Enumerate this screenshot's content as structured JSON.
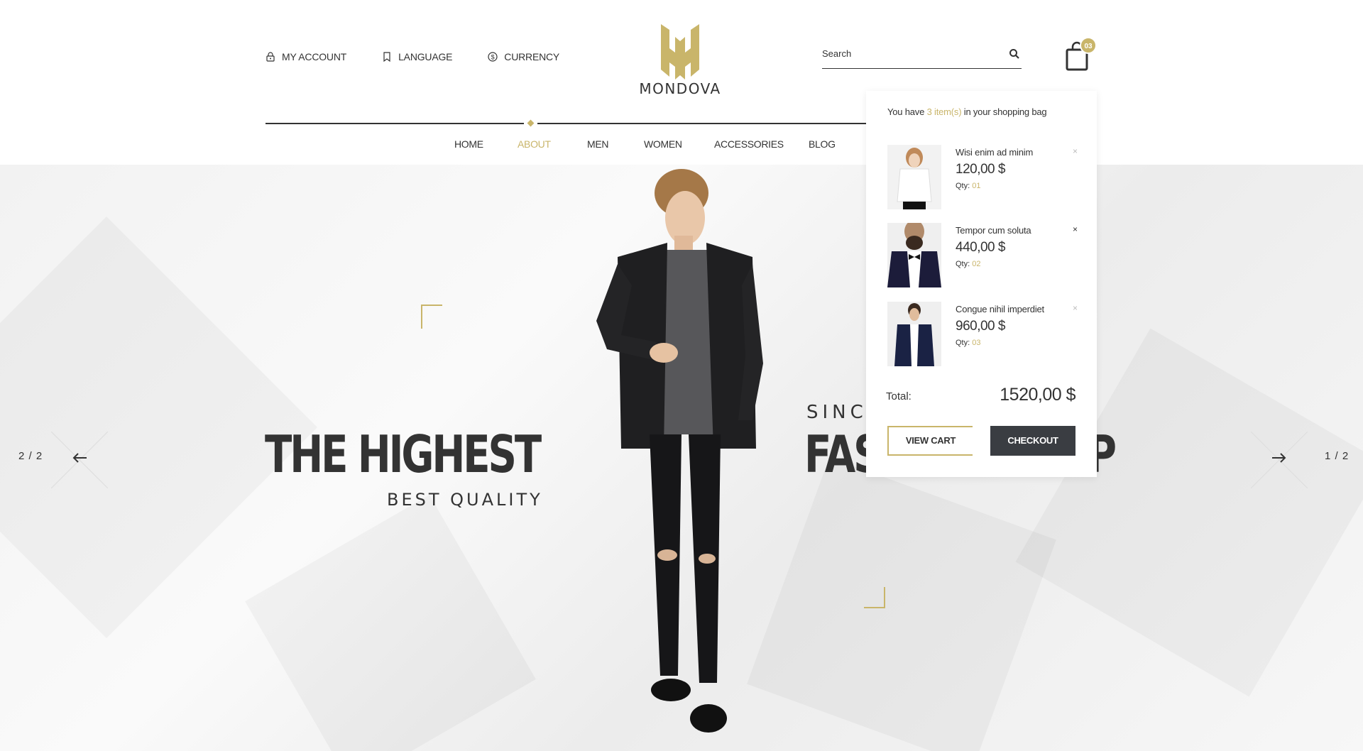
{
  "header": {
    "top_links": [
      {
        "label": "MY ACCOUNT",
        "icon": "lock-icon"
      },
      {
        "label": "LANGUAGE",
        "icon": "bookmark-icon"
      },
      {
        "label": "CURRENCY",
        "icon": "dollar-coin-icon"
      }
    ],
    "logo_text": "MONDOVA",
    "search_placeholder": "Search",
    "cart_count": "03"
  },
  "nav": {
    "items": [
      "HOME",
      "ABOUT",
      "MEN",
      "WOMEN",
      "ACCESSORIES",
      "BLOG"
    ],
    "active": "ABOUT"
  },
  "hero": {
    "left_title": "THE HIGHEST",
    "left_subtitle": "BEST QUALITY",
    "right_kicker": "SINCE",
    "right_title": "FASHION SHOP",
    "prev_counter": "2 / 2",
    "next_counter": "1 / 2"
  },
  "cart": {
    "message_prefix": "You have",
    "message_count": "3 item(s)",
    "message_suffix": "in your shopping bag",
    "items": [
      {
        "name": "Wisi enim ad minim",
        "price": "120,00 $",
        "qty_label": "Qty:",
        "qty": "01"
      },
      {
        "name": "Tempor cum soluta",
        "price": "440,00 $",
        "qty_label": "Qty:",
        "qty": "02"
      },
      {
        "name": "Congue nihil imperdiet",
        "price": "960,00 $",
        "qty_label": "Qty:",
        "qty": "03"
      }
    ],
    "remove_symbol": "×",
    "total_label": "Total:",
    "total_value": "1520,00 $",
    "view_cart": "VIEW CART",
    "checkout": "CHECKOUT"
  },
  "colors": {
    "accent": "#c9b56a",
    "dark": "#333333",
    "button_dark": "#3a3d42"
  }
}
